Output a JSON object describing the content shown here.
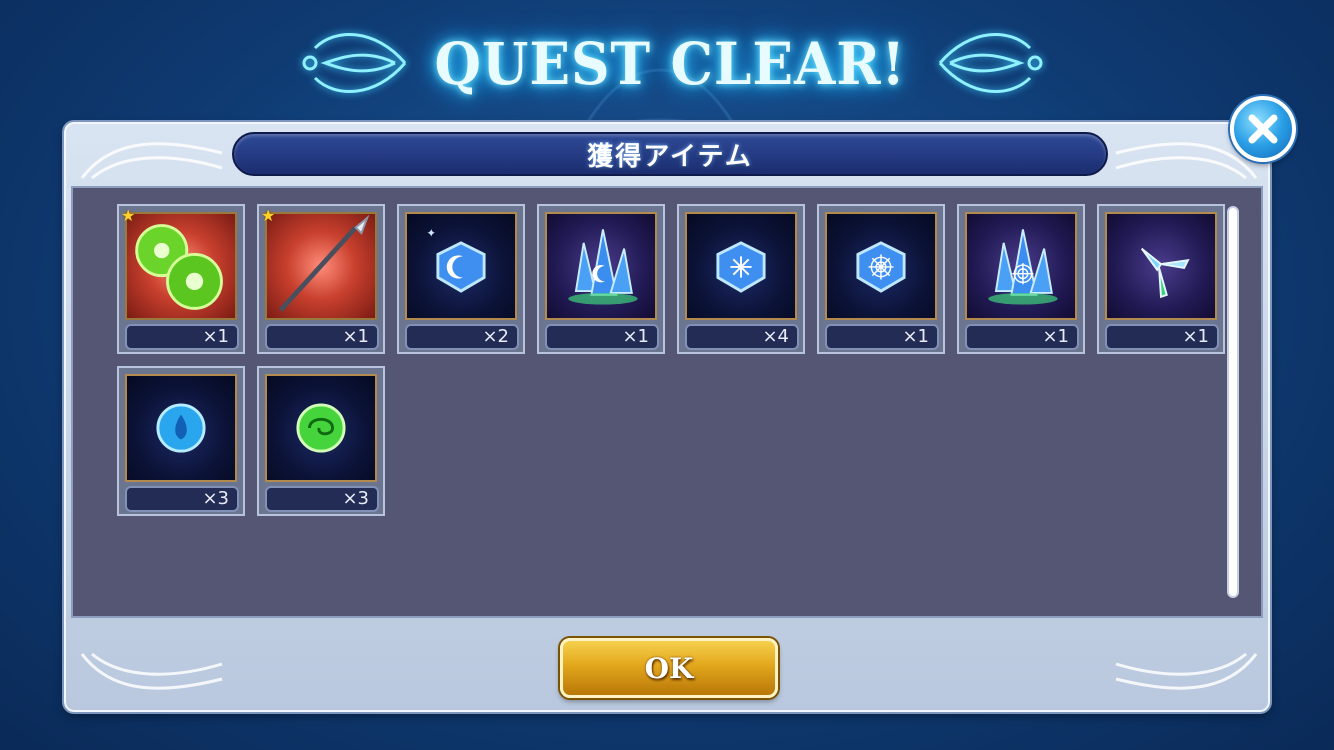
{
  "title": "QUEST CLEAR!",
  "panel": {
    "header": "獲得アイテム",
    "ok_label": "OK"
  },
  "colors": {
    "panel_bg": "#555673",
    "header_bar": "#1b2d70",
    "ok_button": "#e3a71c",
    "close_button": "#2a9fe6",
    "title_glow": "#2bc7ff"
  },
  "items": [
    {
      "icon": "green-seed-icon",
      "quantity": "×1",
      "starred": true
    },
    {
      "icon": "spear-icon",
      "quantity": "×1",
      "starred": true
    },
    {
      "icon": "moon-gem-icon",
      "quantity": "×2",
      "starred": false
    },
    {
      "icon": "moon-crystal-cluster-icon",
      "quantity": "×1",
      "starred": false
    },
    {
      "icon": "star-gem-icon",
      "quantity": "×4",
      "starred": false
    },
    {
      "icon": "web-gem-icon",
      "quantity": "×1",
      "starred": false
    },
    {
      "icon": "web-crystal-cluster-icon",
      "quantity": "×1",
      "starred": false
    },
    {
      "icon": "crystal-shard-icon",
      "quantity": "×1",
      "starred": false
    },
    {
      "icon": "water-orb-icon",
      "quantity": "×3",
      "starred": false
    },
    {
      "icon": "wind-orb-icon",
      "quantity": "×3",
      "starred": false
    }
  ]
}
